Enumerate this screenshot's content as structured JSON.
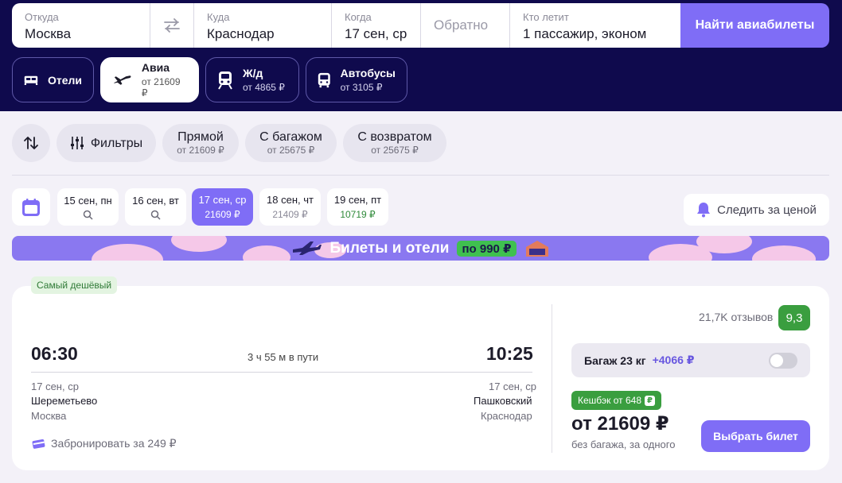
{
  "search": {
    "from_label": "Откуда",
    "from_value": "Москва",
    "to_label": "Куда",
    "to_value": "Краснодар",
    "when_label": "Когда",
    "when_value": "17 сен, ср",
    "back_placeholder": "Обратно",
    "who_label": "Кто летит",
    "who_value": "1 пассажир, эконом",
    "find_label": "Найти авиабилеты"
  },
  "tabs": [
    {
      "label": "Отели",
      "sub": ""
    },
    {
      "label": "Авиа",
      "sub": "от 21609 ₽"
    },
    {
      "label": "Ж/д",
      "sub": "от 4865 ₽"
    },
    {
      "label": "Автобусы",
      "sub": "от 3105 ₽"
    }
  ],
  "filters": {
    "filters_label": "Фильтры",
    "chips": [
      {
        "label": "Прямой",
        "sub": "от 21609 ₽"
      },
      {
        "label": "С багажом",
        "sub": "от 25675 ₽"
      },
      {
        "label": "С возвратом",
        "sub": "от 25675 ₽"
      }
    ]
  },
  "dates": [
    {
      "label": "15 сен, пн",
      "price": ""
    },
    {
      "label": "16 сен, вт",
      "price": ""
    },
    {
      "label": "17 сен, ср",
      "price": "21609 ₽"
    },
    {
      "label": "18 сен, чт",
      "price": "21409 ₽"
    },
    {
      "label": "19 сен, пт",
      "price": "10719 ₽"
    }
  ],
  "track_price_label": "Следить за ценой",
  "banner": {
    "text": "Билеты и отели",
    "price": "по 990 ₽"
  },
  "ticket": {
    "badge": "Самый дешёвый",
    "depart_time": "06:30",
    "arrive_time": "10:25",
    "duration": "3 ч 55 м в пути",
    "depart_date": "17 сен, ср",
    "arrive_date": "17 сен, ср",
    "depart_airport": "Шереметьево",
    "arrive_airport": "Пашковский",
    "depart_city": "Москва",
    "arrive_city": "Краснодар",
    "book_label": "Забронировать за 249 ₽",
    "reviews": "21,7K отзывов",
    "rating": "9,3",
    "baggage_label": "Багаж 23 кг",
    "baggage_price": "+4066 ₽",
    "cashback": "Кешбэк от 648",
    "price": "от 21609 ₽",
    "price_note": "без багажа, за одного",
    "select_label": "Выбрать билет"
  },
  "colors": {
    "header_bg": "#0f0a4d",
    "accent": "#7f6df6",
    "green": "#3a9e3f"
  }
}
